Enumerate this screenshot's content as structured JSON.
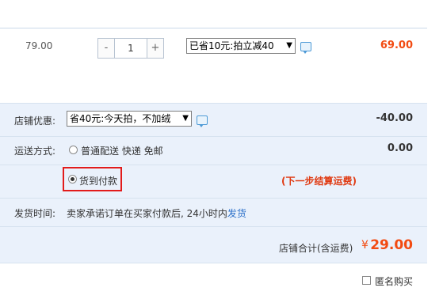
{
  "item": {
    "unit_price": "79.00",
    "quantity": "1",
    "minus_label": "-",
    "plus_label": "+",
    "promo_selected": "已省10元:拍立减40",
    "subtotal": "69.00"
  },
  "shop_discount": {
    "label": "店铺优惠:",
    "selected": "省40元:今天拍，不加绒",
    "amount": "-40.00"
  },
  "shipping": {
    "label": "运送方式:",
    "option_text": "普通配送 快递 免邮",
    "cost": "0.00"
  },
  "payment": {
    "cod_label": "货到付款",
    "note": "(下一步结算运费)"
  },
  "delivery": {
    "label": "发货时间:",
    "text_prefix": "卖家承诺订单在买家付款后, 24小时内",
    "text_link": "发货"
  },
  "summary": {
    "label": "店铺合计(含运费)",
    "currency": "¥",
    "total": "29.00"
  },
  "anonymous": {
    "label": "匿名购买"
  }
}
